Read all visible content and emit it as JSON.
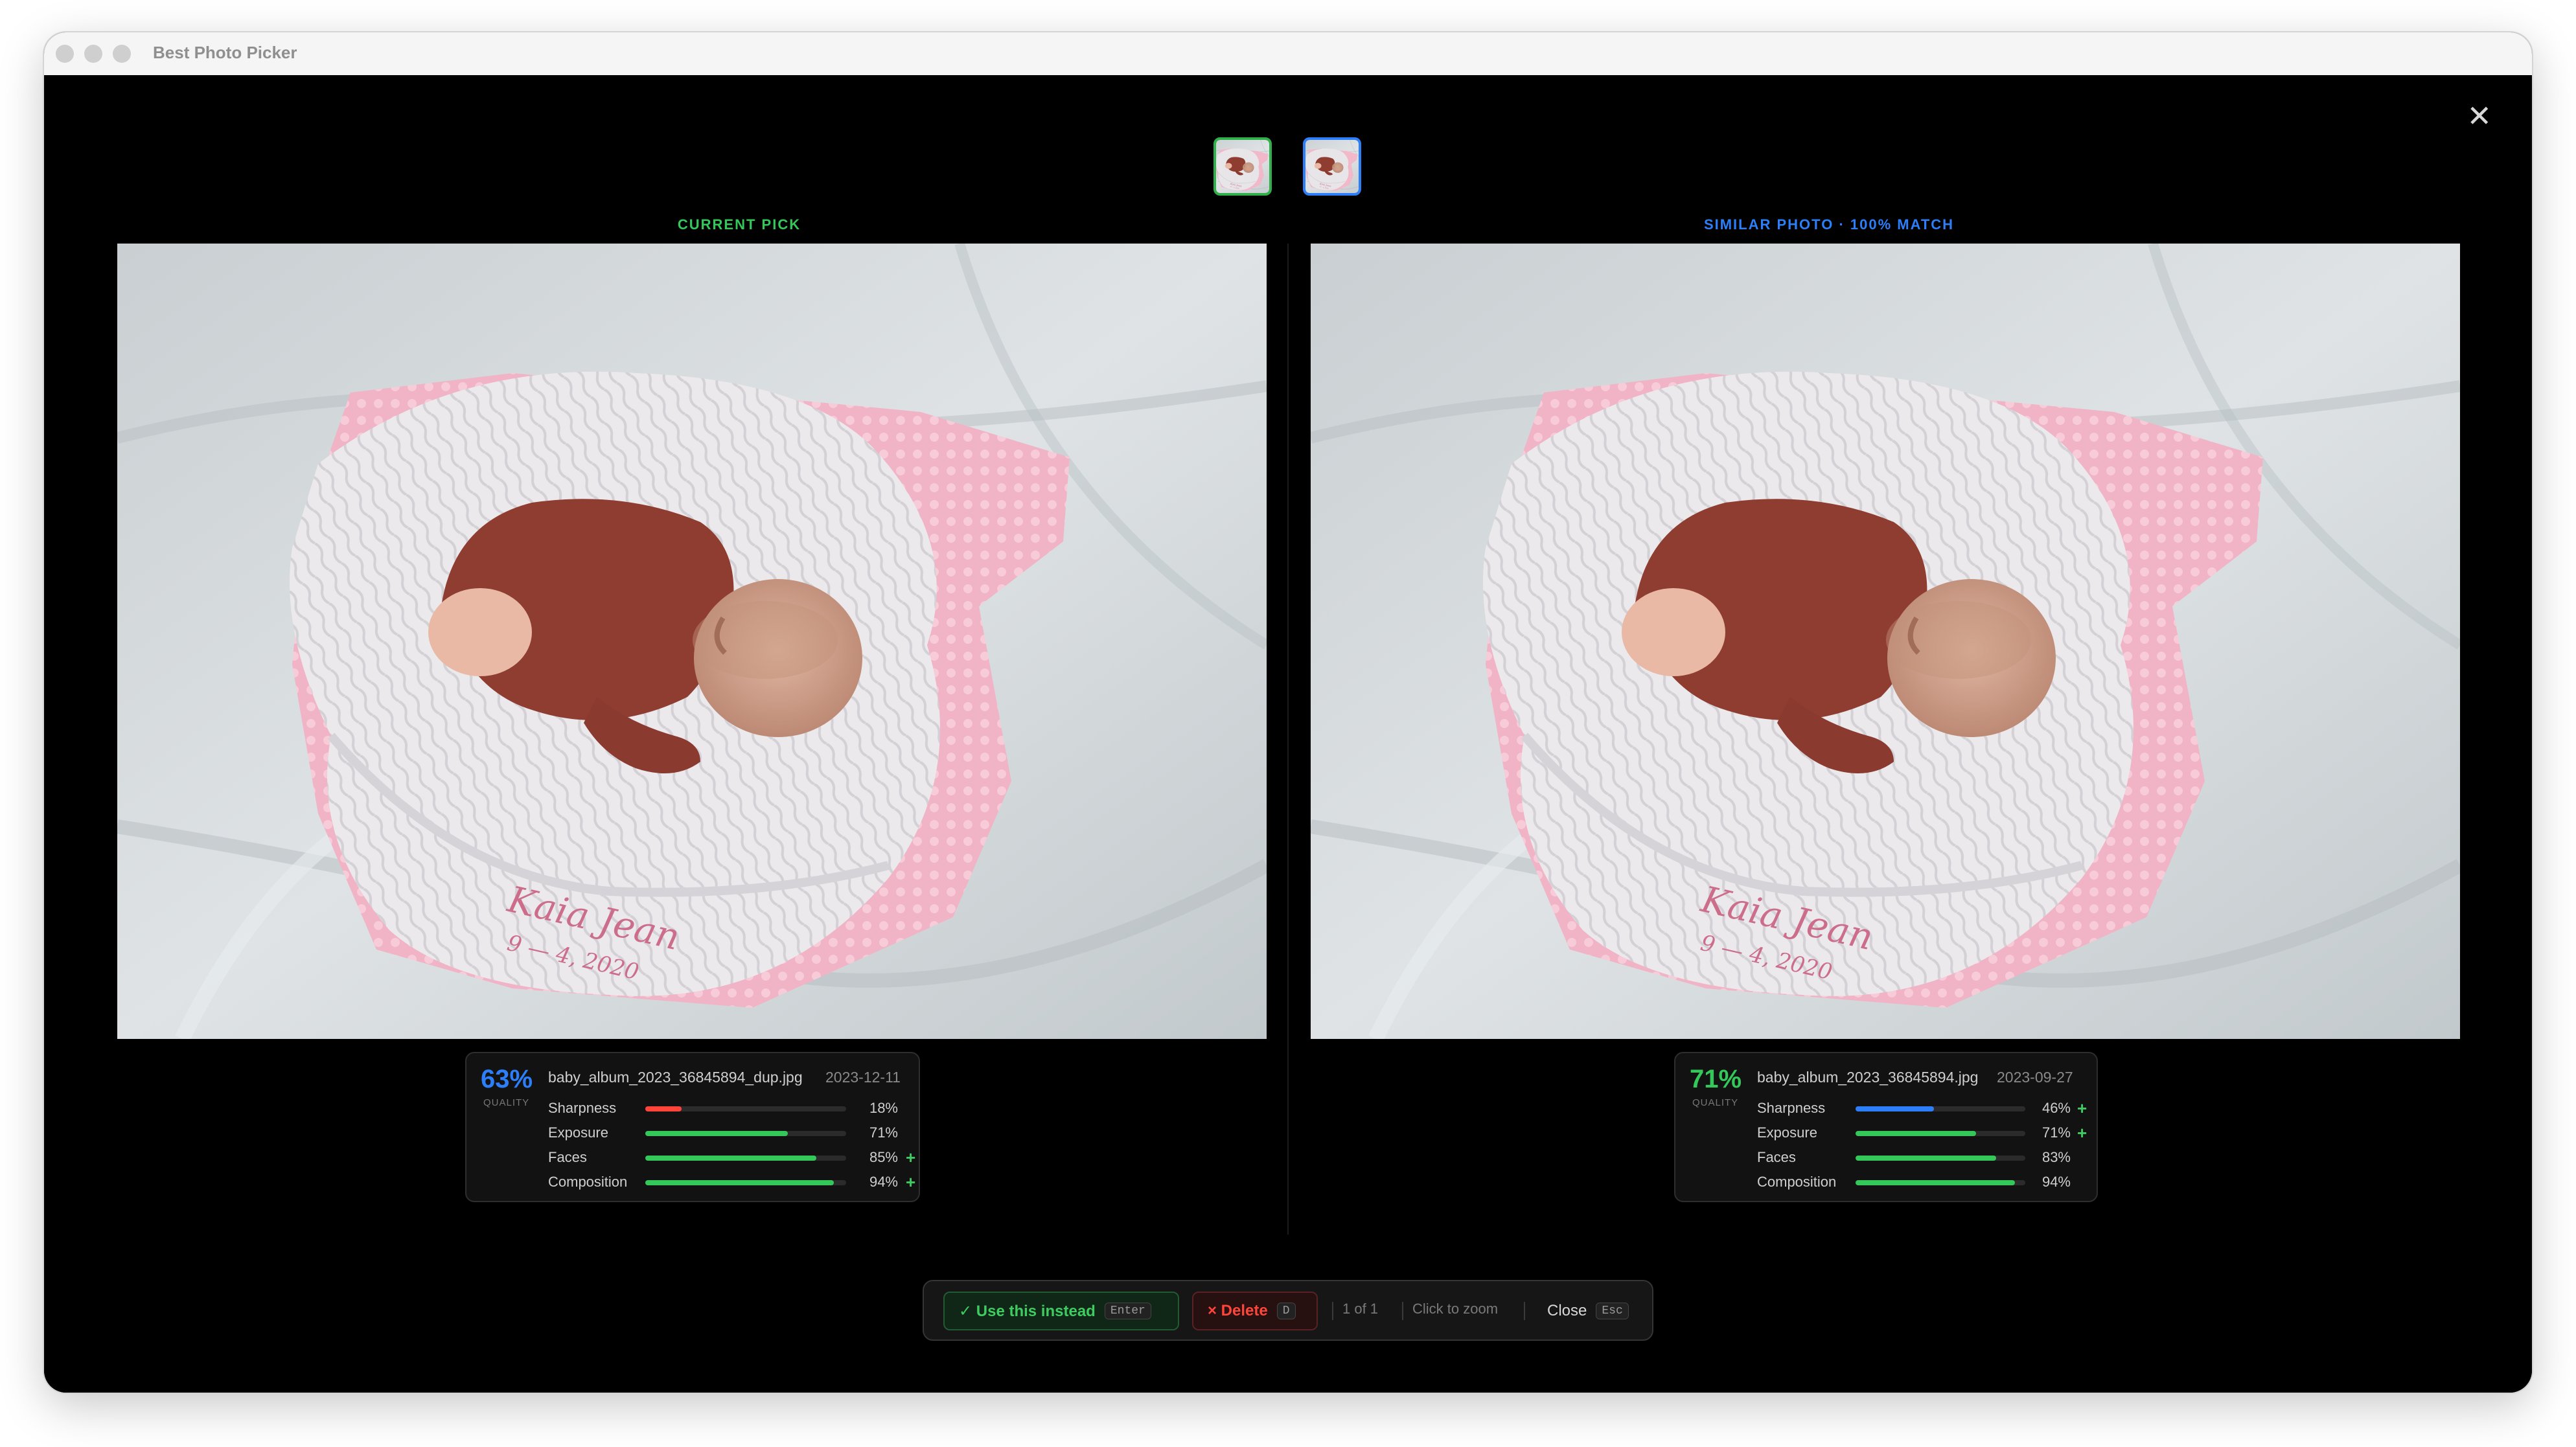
{
  "window": {
    "title": "Best Photo Picker"
  },
  "thumbnails": [
    {
      "name": "current-pick-thumbnail",
      "border_color": "#2fb04b"
    },
    {
      "name": "similar-photo-thumbnail",
      "border_color": "#2d7ff9"
    }
  ],
  "left": {
    "label": "CURRENT PICK",
    "label_color": "#34c759",
    "quality_percent": "63%",
    "quality_label": "QUALITY",
    "quality_color": "#2d7ff9",
    "filename": "baby_album_2023_36845894_dup.jpg",
    "date": "2023-12-11",
    "metrics": [
      {
        "name": "Sharpness",
        "value": "18%",
        "fraction": 0.18,
        "color": "#ff453a",
        "plus": ""
      },
      {
        "name": "Exposure",
        "value": "71%",
        "fraction": 0.71,
        "color": "#34c759",
        "plus": ""
      },
      {
        "name": "Faces",
        "value": "85%",
        "fraction": 0.85,
        "color": "#34c759",
        "plus": "+"
      },
      {
        "name": "Composition",
        "value": "94%",
        "fraction": 0.94,
        "color": "#34c759",
        "plus": "+"
      }
    ],
    "embroidery": {
      "line1": "Kaia Jean",
      "line2": "9 — 4, 2020"
    }
  },
  "right": {
    "label": "SIMILAR PHOTO · 100% MATCH",
    "label_color": "#2d7ff9",
    "quality_percent": "71%",
    "quality_label": "QUALITY",
    "quality_color": "#34c759",
    "filename": "baby_album_2023_36845894.jpg",
    "date": "2023-09-27",
    "metrics": [
      {
        "name": "Sharpness",
        "value": "46%",
        "fraction": 0.46,
        "color": "#2d7ff9",
        "plus": "+"
      },
      {
        "name": "Exposure",
        "value": "71%",
        "fraction": 0.71,
        "color": "#34c759",
        "plus": "+"
      },
      {
        "name": "Faces",
        "value": "83%",
        "fraction": 0.83,
        "color": "#34c759",
        "plus": ""
      },
      {
        "name": "Composition",
        "value": "94%",
        "fraction": 0.94,
        "color": "#34c759",
        "plus": ""
      }
    ],
    "embroidery": {
      "line1": "Kaia Jean",
      "line2": "9 — 4, 2020"
    }
  },
  "toolbar": {
    "use_label": "✓ Use this instead",
    "use_key": "Enter",
    "delete_label": "× Delete",
    "delete_key": "D",
    "position": "1 of 1",
    "zoom_hint": "Click to zoom",
    "close_label": "Close",
    "close_key": "Esc"
  },
  "icons": {
    "close": "close-icon",
    "check": "check-icon",
    "delete": "x-icon"
  }
}
